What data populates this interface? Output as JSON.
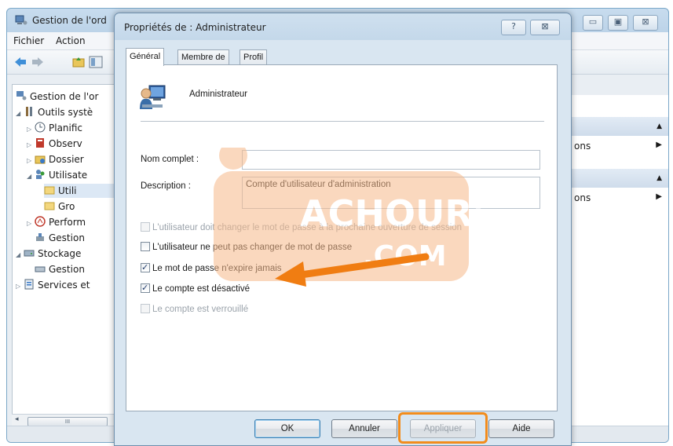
{
  "background_window": {
    "title": "Gestion de l'ord",
    "menu": [
      "Fichier",
      "Action"
    ],
    "tree": [
      {
        "label": "Gestion de l'or",
        "expander": ""
      },
      {
        "label": "Outils systè",
        "expander": "◢"
      },
      {
        "label": "Planific",
        "expander": "▷"
      },
      {
        "label": "Observ",
        "expander": "▷"
      },
      {
        "label": "Dossier",
        "expander": "▷"
      },
      {
        "label": "Utilisate",
        "expander": "◢"
      },
      {
        "label": "Utili",
        "expander": ""
      },
      {
        "label": "Gro",
        "expander": ""
      },
      {
        "label": "Perform",
        "expander": "▷"
      },
      {
        "label": "Gestion",
        "expander": ""
      },
      {
        "label": "Stockage",
        "expander": "◢"
      },
      {
        "label": "Gestion",
        "expander": ""
      },
      {
        "label": "Services et",
        "expander": "▷"
      }
    ],
    "actions": [
      "ons",
      "ons"
    ],
    "scroll_thumb": "III",
    "caption_buttons": [
      "▭",
      "▣",
      "⊠"
    ]
  },
  "dialog": {
    "title": "Propriétés de : Administrateur",
    "help_button": "?",
    "close_button": "⊠",
    "tabs": [
      "Général",
      "Membre de",
      "Profil"
    ],
    "active_tab": "Général",
    "user_name": "Administrateur",
    "full_name_label": "Nom complet :",
    "full_name_value": "",
    "description_label": "Description :",
    "description_value": "Compte d'utilisateur d'administration",
    "checkboxes": [
      {
        "label": "L'utilisateur doit changer le mot de passe à la prochaine ouverture de session",
        "checked": false,
        "enabled": false
      },
      {
        "label": "L'utilisateur ne peut pas changer de mot de passe",
        "checked": false,
        "enabled": true
      },
      {
        "label": "Le mot de passe n'expire jamais",
        "checked": true,
        "enabled": true
      },
      {
        "label": "Le compte est désactivé",
        "checked": true,
        "enabled": true
      },
      {
        "label": "Le compte est verrouillé",
        "checked": false,
        "enabled": false
      }
    ],
    "buttons": {
      "ok": "OK",
      "cancel": "Annuler",
      "apply": "Appliquer",
      "help": "Aide"
    }
  },
  "watermark": {
    "line1": "ACHOURI",
    "line2": ".COM"
  },
  "colors": {
    "highlight": "#f28c1c",
    "arrow": "#f07d12",
    "window_frame": "#c4d8ea"
  }
}
